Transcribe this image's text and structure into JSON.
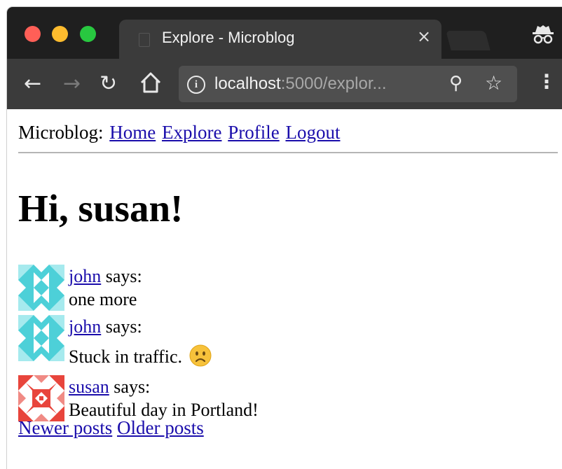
{
  "browser": {
    "tab_title": "Explore - Microblog",
    "tab_close": "×",
    "url_host": "localhost",
    "url_rest": ":5000/explor...",
    "colors": {
      "close": "#ff5f57",
      "minimize": "#febc2e",
      "maximize": "#28c840"
    },
    "icons": [
      "back-arrow-icon",
      "forward-arrow-icon",
      "reload-icon",
      "home-icon",
      "info-icon",
      "zoom-icon",
      "star-icon",
      "menu-icon",
      "incognito-icon"
    ]
  },
  "page": {
    "nav": {
      "prefix": "Microblog:",
      "links": [
        "Home",
        "Explore",
        "Profile",
        "Logout"
      ]
    },
    "greeting": "Hi, susan!",
    "posts": [
      {
        "author": "john",
        "says": "says:",
        "body": "one more",
        "avatar_color": "#4dd0d8"
      },
      {
        "author": "john",
        "says": "says:",
        "body": "Stuck in traffic.",
        "emoji": "frowning-face-icon",
        "avatar_color": "#4dd0d8"
      },
      {
        "author": "susan",
        "says": "says:",
        "body": "Beautiful day in Portland!",
        "avatar_color": "#e8453c"
      }
    ],
    "pagination": {
      "newer": "Newer posts",
      "older": "Older posts"
    },
    "link_color": "#1a0dab"
  }
}
